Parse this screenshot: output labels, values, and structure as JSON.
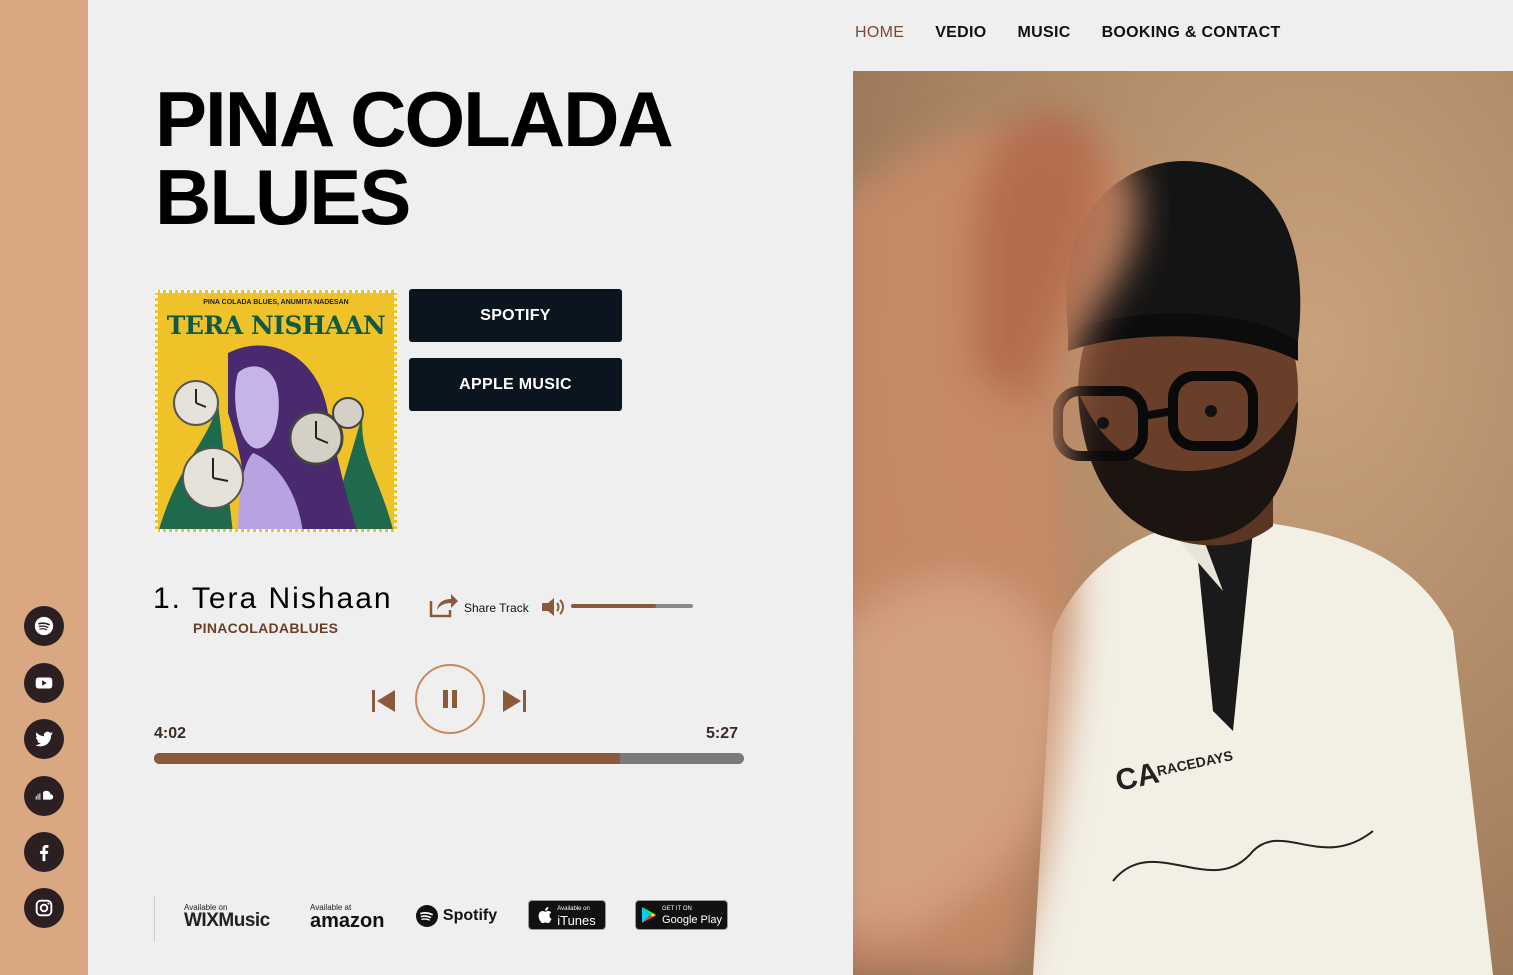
{
  "nav": {
    "items": [
      "HOME",
      "VEDIO",
      "MUSIC",
      "BOOKING & CONTACT"
    ]
  },
  "hero": {
    "title_line1": "PINA COLADA",
    "title_line2": "BLUES"
  },
  "album": {
    "artists": "PINA COLADA BLUES, ANUMITA NADESAN",
    "name": "TERA NISHAAN"
  },
  "buttons": {
    "spotify": "SPOTIFY",
    "apple": "APPLE MUSIC"
  },
  "track": {
    "title": "1. Tera Nishaan",
    "artist": "PINACOLADABLUES",
    "share_label": "Share Track",
    "current_time": "4:02",
    "total_time": "5:27",
    "progress": 0.79,
    "volume": 0.7
  },
  "social": [
    "spotify-icon",
    "youtube-icon",
    "twitter-icon",
    "soundcloud-icon",
    "facebook-icon",
    "instagram-icon"
  ],
  "stores": {
    "wix_small": "Available on",
    "wix": "WIXMusic",
    "amazon_small": "Available at",
    "amazon": "amazon",
    "spotify": "Spotify",
    "itunes_small": "Available on",
    "itunes": "iTunes",
    "gplay_small": "GET IT ON",
    "gplay": "Google Play"
  },
  "colors": {
    "sidebar": "#d9a883",
    "accent": "#8b5a3c",
    "button_bg": "#0b1520",
    "page_bg": "#efefef"
  }
}
